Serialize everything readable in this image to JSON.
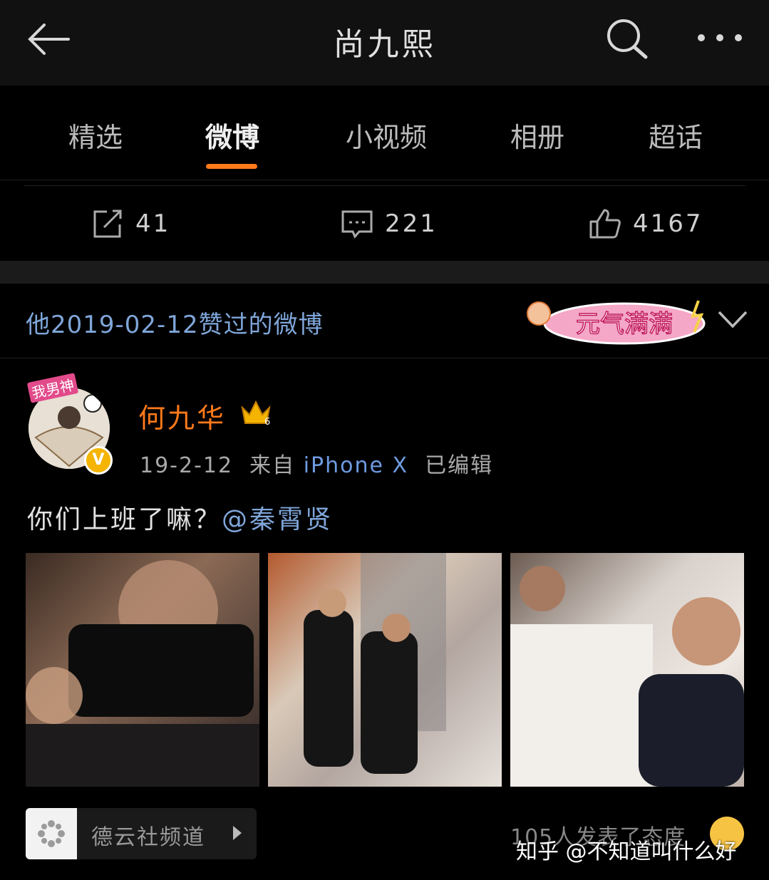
{
  "header": {
    "title": "尚九熙"
  },
  "tabs": [
    {
      "label": "精选"
    },
    {
      "label": "微博"
    },
    {
      "label": "小视频"
    },
    {
      "label": "相册"
    },
    {
      "label": "超话"
    }
  ],
  "stats": {
    "reposts": "41",
    "comments": "221",
    "likes": "4167"
  },
  "liked_section": {
    "text": "他2019-02-12赞过的微博",
    "sticker_text": "元气满满"
  },
  "post": {
    "avatar_tag": "我男神",
    "username": "何九华",
    "crown_level": "6",
    "verified": "V",
    "date": "19-2-12",
    "from_label": "来自",
    "device": "iPhone X",
    "edited": "已编辑",
    "text": "你们上班了嘛？",
    "mention": "@秦霄贤"
  },
  "footer": {
    "channel": "德云社频道",
    "shows": "105人发表了态度"
  },
  "watermark": "知乎 @不知道叫什么好",
  "colors": {
    "accent": "#ff7a1a",
    "link": "#7fa6d9",
    "background": "#000000"
  }
}
